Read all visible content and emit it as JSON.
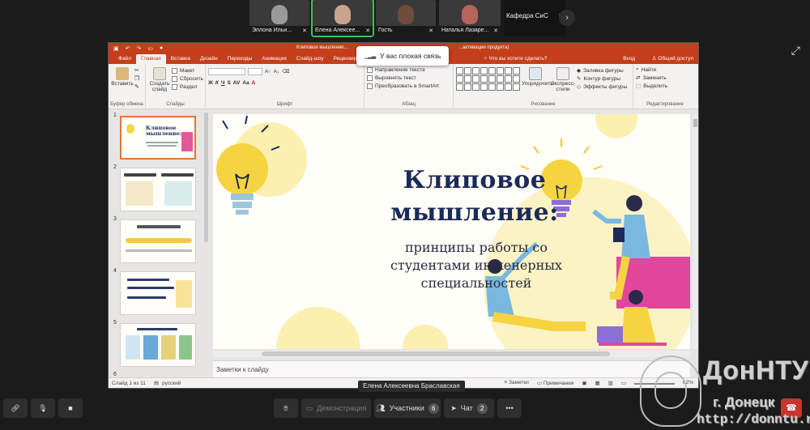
{
  "participants": [
    {
      "name": "Эллона Ильи...",
      "muted": true
    },
    {
      "name": "Елена Алексее...",
      "muted": true
    },
    {
      "name": "Гость",
      "muted": true
    },
    {
      "name": "Наталья Лазаре...",
      "muted": true
    },
    {
      "name": "Кафедра СиС",
      "muted": true
    }
  ],
  "mic_off_icon": "mic-off-icon",
  "ppt": {
    "document_title": "Клиповое мышление...",
    "activation_note": "...активации продукта)",
    "tabs": [
      "Файл",
      "Главная",
      "Вставка",
      "Дизайн",
      "Переходы",
      "Анимация",
      "Слайд-шоу",
      "Рецензирование"
    ],
    "active_tab": "Главная",
    "tab_element": "element",
    "tell_me": "Что вы хотите сделать?",
    "login": "Вход",
    "share": "Общий доступ",
    "ribbon": {
      "paste": "Вставить",
      "clipboard": "Буфер обмена",
      "new_slide": "Создать слайд",
      "layout": "Макет",
      "reset": "Сбросить",
      "section": "Раздел",
      "slides": "Слайды",
      "font_group": "Шрифт",
      "text_direction": "Направление текста",
      "align_text": "Выровнять текст",
      "smartart": "Преобразовать в SmartArt",
      "paragraph": "Абзац",
      "arrange": "Упорядочить",
      "quick_styles": "Экспресс-стили",
      "shape_fill": "Заливка фигуры",
      "shape_outline": "Контур фигуры",
      "shape_effects": "Эффекты фигуры",
      "drawing": "Рисование",
      "find": "Найти",
      "replace": "Заменить",
      "select": "Выделить",
      "editing": "Редактирование"
    },
    "thumbnails": [
      "1",
      "2",
      "3",
      "4",
      "5",
      "6"
    ],
    "thumb1_title": "Клиповое мышление:",
    "slide": {
      "title_line1": "Клиповое",
      "title_line2": "мышление:",
      "subtitle": "принципы работы со студентами инженерных специальностей"
    },
    "notes_placeholder": "Заметки к слайду",
    "status_slide": "Слайд 1 из 11",
    "status_lang": "русский",
    "status_notes": "Заметки",
    "status_comments": "Примечания",
    "status_zoom": "62%"
  },
  "network_toast": "У вас плохая связь",
  "presenter_label": "Елена Алексеевна Браславская",
  "controls": {
    "demonstration": "Демонстрация",
    "participants": "Участники",
    "participants_count": "6",
    "chat": "Чат",
    "chat_count": "2"
  },
  "watermark": {
    "line1": "ДонНТУ",
    "line2": "г. Донецк",
    "line3": "http://donntu.ru"
  },
  "colors": {
    "ppt_accent": "#c43e1c",
    "slide_title": "#1c2a5a",
    "speaking_outline": "#3fbf5a",
    "hangup": "#c9342c"
  }
}
